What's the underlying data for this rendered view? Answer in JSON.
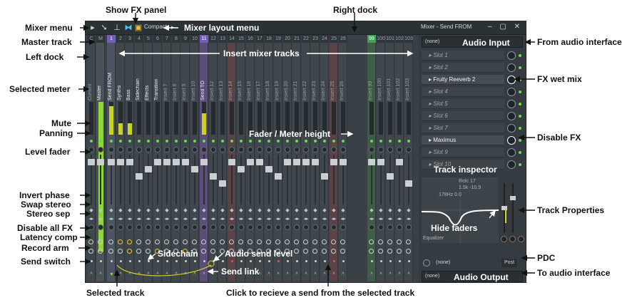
{
  "mixer": {
    "toolbar_compact": "Compact",
    "window_title": "Mixer - Send FROM",
    "window_buttons": "– ▢ ✕"
  },
  "tracks": [
    {
      "num": "C",
      "label": "Current"
    },
    {
      "num": "M",
      "label": "Master"
    },
    {
      "num": "1",
      "label": "Send FROM"
    },
    {
      "num": "2",
      "label": "Synths"
    },
    {
      "num": "3",
      "label": "Bass"
    },
    {
      "num": "4",
      "label": "Sidechain"
    },
    {
      "num": "5",
      "label": "Effects"
    },
    {
      "num": "6",
      "label": "Transition"
    },
    {
      "num": "7",
      "label": "Insert 7"
    },
    {
      "num": "8",
      "label": "Insert 8"
    },
    {
      "num": "9",
      "label": "Insert 9"
    },
    {
      "num": "10",
      "label": "Insert 10"
    },
    {
      "num": "11",
      "label": "Send TO"
    },
    {
      "num": "12",
      "label": "Insert 12"
    },
    {
      "num": "13",
      "label": "Insert 13"
    },
    {
      "num": "14",
      "label": "Insert 14"
    },
    {
      "num": "15",
      "label": "Insert 15"
    },
    {
      "num": "16",
      "label": "Insert 16"
    },
    {
      "num": "17",
      "label": "Insert 17"
    },
    {
      "num": "18",
      "label": "Insert 18"
    },
    {
      "num": "19",
      "label": "Insert 19"
    },
    {
      "num": "20",
      "label": "Insert 20"
    },
    {
      "num": "21",
      "label": "Insert 21"
    },
    {
      "num": "22",
      "label": "Insert 22"
    },
    {
      "num": "23",
      "label": "Insert 23"
    },
    {
      "num": "24",
      "label": "Insert 24"
    },
    {
      "num": "25",
      "label": "Insert 25"
    },
    {
      "num": "26",
      "label": "Insert 26"
    },
    {
      "num": "99",
      "label": "Insert 99"
    },
    {
      "num": "100",
      "label": "Insert 100"
    },
    {
      "num": "101",
      "label": "Insert 101"
    },
    {
      "num": "102",
      "label": "Insert 102"
    },
    {
      "num": "103",
      "label": "Insert 103"
    }
  ],
  "dock_right_first": {
    "num": "20",
    "label": "Insert 20"
  },
  "panel": {
    "input_value": "(none)",
    "input_label": "Audio Input",
    "slots": [
      "Slot 1",
      "Slot 2",
      "Fruity Reeverb 2",
      "Slot 4",
      "Slot 5",
      "Slot 6",
      "Slot 7",
      "Maximus",
      "Slot 9",
      "Slot 10"
    ],
    "eq_label": "Equalizer",
    "eq_readout1": "Rolc 17",
    "eq_readout2": "1.5k -10.9",
    "eq_readout3": "178Hz 0.0",
    "pdc_value": "(none)",
    "pdc_mode": "Post",
    "output_value": "(none)",
    "output_label": "Audio Output"
  },
  "annotations": {
    "show_fx_panel": "Show FX panel",
    "right_dock": "Right dock",
    "mixer_menu": "Mixer menu",
    "mixer_layout_menu": "Mixer layout menu",
    "master_track": "Master track",
    "insert_mixer_tracks": "Insert mixer tracks",
    "left_dock": "Left dock",
    "selected_meter": "Selected meter",
    "mute": "Mute",
    "panning": "Panning",
    "fader_meter_height": "Fader / Meter height",
    "level_fader": "Level fader",
    "invert_phase": "Invert phase",
    "swap_stereo": "Swap stereo",
    "stereo_sep": "Stereo sep",
    "disable_all_fx": "Disable all FX",
    "latency_comp": "Latency comp",
    "record_arm": "Record arm",
    "send_switch": "Send switch",
    "sidechain": "Sidechain",
    "audio_send_level": "Audio send level",
    "send_link": "Send link",
    "selected_track": "Selected track",
    "click_receive": "Click to recieve a send from the selected track",
    "from_audio_interface": "From audio interface",
    "fx_wet_mix": "FX wet mix",
    "disable_fx": "Disable FX",
    "track_inspector": "Track inspector",
    "track_properties": "Track Properties",
    "hide_faders": "Hide faders",
    "pdc": "PDC",
    "to_audio_interface": "To audio interface"
  }
}
